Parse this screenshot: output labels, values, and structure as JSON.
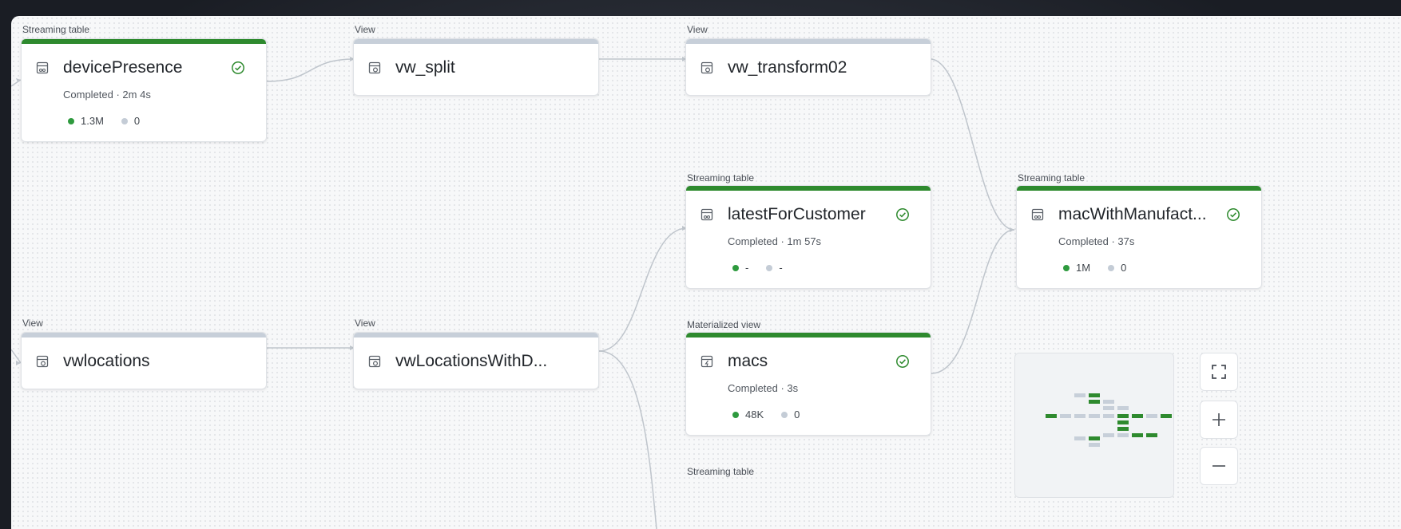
{
  "nodes": {
    "devicePresence": {
      "type": "Streaming table",
      "name": "devicePresence",
      "status": "Completed · 2m 4s",
      "output": "1.3M",
      "dropped": "0"
    },
    "vw_split": {
      "type": "View",
      "name": "vw_split"
    },
    "vw_transform02": {
      "type": "View",
      "name": "vw_transform02"
    },
    "latestForCustomer": {
      "type": "Streaming table",
      "name": "latestForCustomer",
      "status": "Completed · 1m 57s",
      "output": "-",
      "dropped": "-"
    },
    "macWithManufacturer": {
      "type": "Streaming table",
      "name": "macWithManufact...",
      "status": "Completed · 37s",
      "output": "1M",
      "dropped": "0"
    },
    "vwlocations": {
      "type": "View",
      "name": "vwlocations"
    },
    "vwLocationsWithD": {
      "type": "View",
      "name": "vwLocationsWithD..."
    },
    "macs": {
      "type": "Materialized view",
      "name": "macs",
      "status": "Completed · 3s",
      "output": "48K",
      "dropped": "0"
    },
    "bottom": {
      "type": "Streaming table"
    }
  },
  "colors": {
    "completed_bar": "#2e8a2e",
    "view_bar": "#c7cfd9",
    "check": "#2e8a2e"
  },
  "icons": [
    "streaming-table-icon",
    "view-icon",
    "materialized-view-icon",
    "check-circle-icon",
    "fullscreen-icon",
    "zoom-in-icon",
    "zoom-out-icon"
  ]
}
